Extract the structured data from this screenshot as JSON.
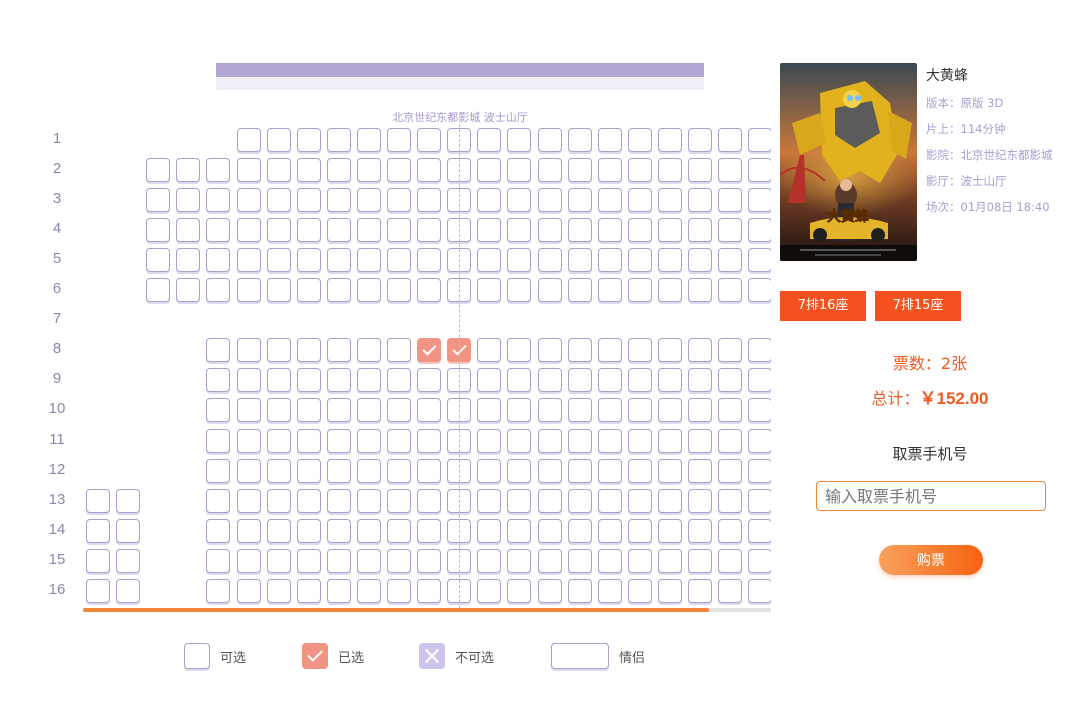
{
  "screen": {
    "hall_name": "北京世纪东都影城 波士山厅"
  },
  "seat_map": {
    "row_labels": [
      "1",
      "2",
      "3",
      "4",
      "5",
      "6",
      "7",
      "8",
      "9",
      "10",
      "11",
      "12",
      "13",
      "14",
      "15",
      "16"
    ],
    "column_count": 24,
    "rows": [
      {
        "row": "1",
        "seat_columns": [
          6,
          7,
          8,
          9,
          10,
          11,
          12,
          13,
          14,
          15,
          16,
          17,
          18,
          19,
          20,
          21,
          22,
          23,
          24
        ]
      },
      {
        "row": "2",
        "seat_columns": [
          3,
          4,
          5,
          6,
          7,
          8,
          9,
          10,
          11,
          12,
          13,
          14,
          15,
          16,
          17,
          18,
          19,
          20,
          21,
          22,
          23,
          24
        ]
      },
      {
        "row": "3",
        "seat_columns": [
          3,
          4,
          5,
          6,
          7,
          8,
          9,
          10,
          11,
          12,
          13,
          14,
          15,
          16,
          17,
          18,
          19,
          20,
          21,
          22,
          23,
          24
        ]
      },
      {
        "row": "4",
        "seat_columns": [
          3,
          4,
          5,
          6,
          7,
          8,
          9,
          10,
          11,
          12,
          13,
          14,
          15,
          16,
          17,
          18,
          19,
          20,
          21,
          22,
          23,
          24
        ]
      },
      {
        "row": "5",
        "seat_columns": [
          3,
          4,
          5,
          6,
          7,
          8,
          9,
          10,
          11,
          12,
          13,
          14,
          15,
          16,
          17,
          18,
          19,
          20,
          21,
          22,
          23,
          24
        ]
      },
      {
        "row": "6",
        "seat_columns": [
          3,
          4,
          5,
          6,
          7,
          8,
          9,
          10,
          11,
          12,
          13,
          14,
          15,
          16,
          17,
          18,
          19,
          20,
          21,
          22,
          23,
          24
        ]
      },
      {
        "row": "7",
        "seat_columns": []
      },
      {
        "row": "8",
        "seat_columns": [
          5,
          6,
          7,
          8,
          9,
          10,
          11,
          12,
          13,
          14,
          15,
          16,
          17,
          18,
          19,
          20,
          21,
          22,
          23,
          24
        ]
      },
      {
        "row": "9",
        "seat_columns": [
          5,
          6,
          7,
          8,
          9,
          10,
          11,
          12,
          13,
          14,
          15,
          16,
          17,
          18,
          19,
          20,
          21,
          22,
          23,
          24
        ]
      },
      {
        "row": "10",
        "seat_columns": [
          5,
          6,
          7,
          8,
          9,
          10,
          11,
          12,
          13,
          14,
          15,
          16,
          17,
          18,
          19,
          20,
          21,
          22,
          23,
          24
        ]
      },
      {
        "row": "11",
        "seat_columns": [
          5,
          6,
          7,
          8,
          9,
          10,
          11,
          12,
          13,
          14,
          15,
          16,
          17,
          18,
          19,
          20,
          21,
          22,
          23,
          24
        ]
      },
      {
        "row": "12",
        "seat_columns": [
          5,
          6,
          7,
          8,
          9,
          10,
          11,
          12,
          13,
          14,
          15,
          16,
          17,
          18,
          19,
          20,
          21,
          22,
          23,
          24
        ]
      },
      {
        "row": "13",
        "seat_columns": [
          1,
          2,
          5,
          6,
          7,
          8,
          9,
          10,
          11,
          12,
          13,
          14,
          15,
          16,
          17,
          18,
          19,
          20,
          21,
          22,
          23,
          24
        ]
      },
      {
        "row": "14",
        "seat_columns": [
          1,
          2,
          5,
          6,
          7,
          8,
          9,
          10,
          11,
          12,
          13,
          14,
          15,
          16,
          17,
          18,
          19,
          20,
          21,
          22,
          23,
          24
        ]
      },
      {
        "row": "15",
        "seat_columns": [
          1,
          2,
          5,
          6,
          7,
          8,
          9,
          10,
          11,
          12,
          13,
          14,
          15,
          16,
          17,
          18,
          19,
          20,
          21,
          22,
          23,
          24
        ]
      },
      {
        "row": "16",
        "seat_columns": [
          1,
          2,
          5,
          6,
          7,
          8,
          9,
          10,
          11,
          12,
          13,
          14,
          15,
          16,
          17,
          18,
          19,
          20,
          21,
          22,
          23,
          24
        ]
      }
    ],
    "selected_seats": [
      {
        "row": "8",
        "column": 12
      },
      {
        "row": "8",
        "column": 13
      }
    ],
    "scroll_position_fraction": 0.91
  },
  "legend": {
    "available": "可选",
    "selected": "已选",
    "unavailable": "不可选",
    "couple": "情侣"
  },
  "movie": {
    "title": "大黄蜂",
    "version": "版本：原版 3D",
    "duration": "片上：114分钟",
    "cinema": "影院：北京世纪东都影城",
    "hall": "影厅：波士山厅",
    "showtime": "场次：01月08日 18:40",
    "poster_title_text": "大黄蜂"
  },
  "order": {
    "tickets": [
      "7排16座",
      "7排15座"
    ],
    "count_label": "票数：2张",
    "total_label": "总计：",
    "total_amount": "￥152.00",
    "phone_label": "取票手机号",
    "phone_placeholder": "输入取票手机号",
    "buy_label": "购票"
  },
  "colors": {
    "accent_purple": "#b3a5d4",
    "seat_border": "#a89fcf",
    "selected_seat": "#f19483",
    "unavailable_seat": "#cdc3ec",
    "orange_primary": "#f4511e",
    "price_orange": "#f05a22"
  }
}
